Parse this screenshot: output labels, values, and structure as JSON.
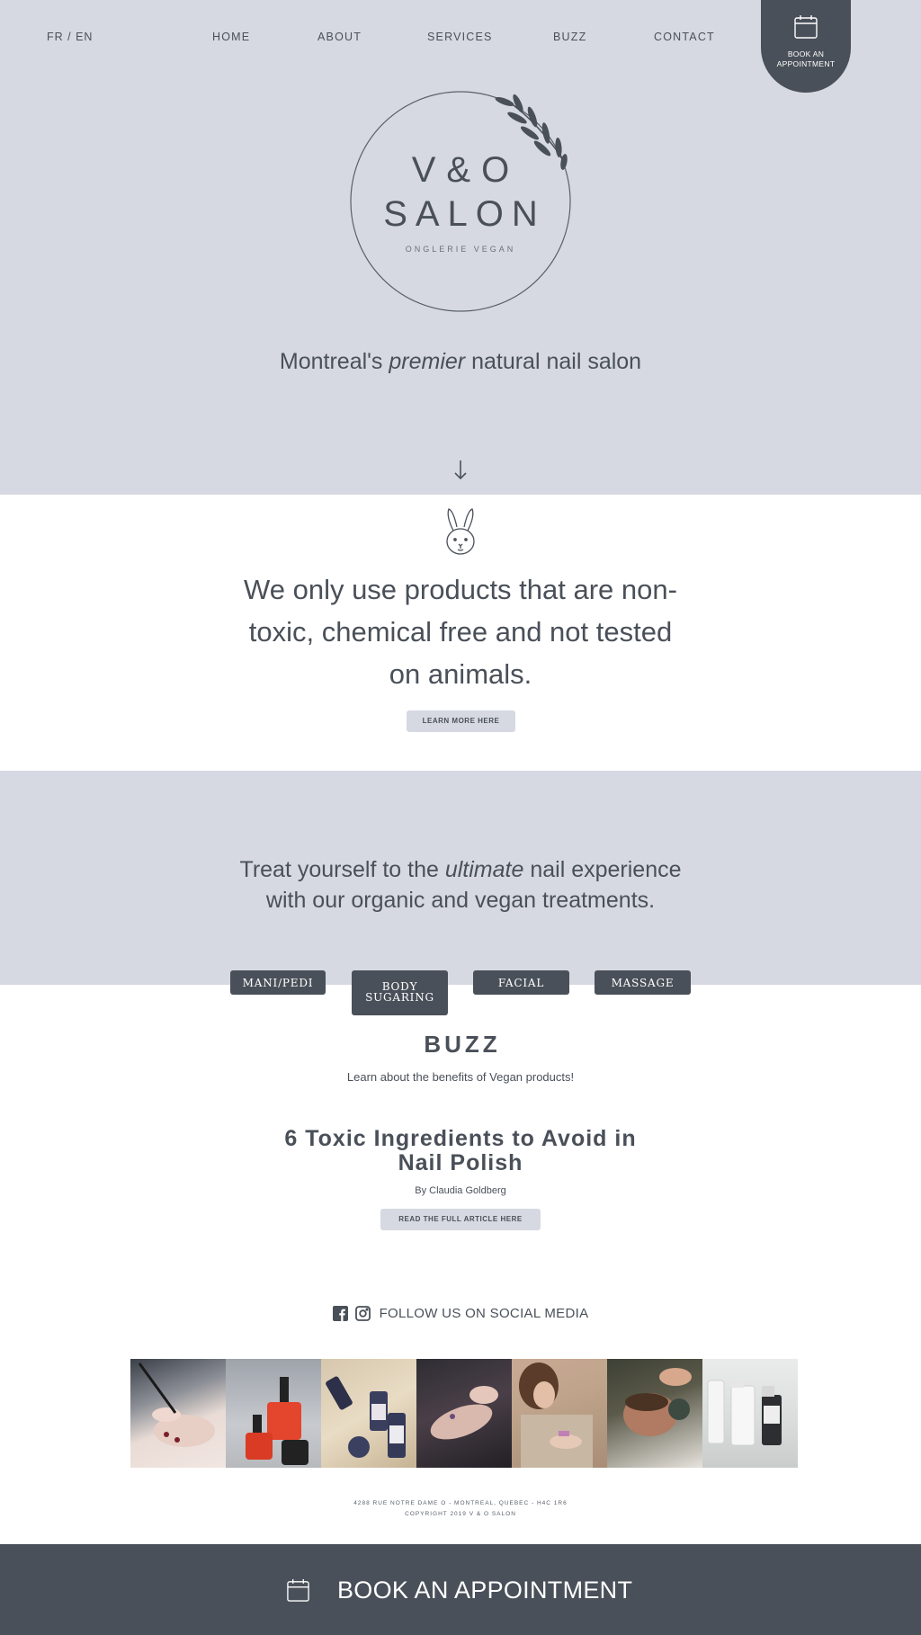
{
  "header": {
    "lang_switch": "FR / EN",
    "nav": [
      "HOME",
      "ABOUT",
      "SERVICES",
      "BUZZ",
      "CONTACT"
    ],
    "book_tab": "BOOK AN\nAPPOINTMENT"
  },
  "logo": {
    "line1": "V&O",
    "line2": "SALON",
    "sub": "ONGLERIE VEGAN"
  },
  "hero": {
    "tagline_a": "Montreal's ",
    "tagline_em": "premier",
    "tagline_b": " natural nail salon"
  },
  "products": {
    "text": "We only use products that are non-toxic, chemical free and not tested on animals.",
    "button": "LEARN MORE HERE"
  },
  "treatments": {
    "line1_a": "Treat yourself to the ",
    "line1_em": "ultimate",
    "line1_b": " nail experience",
    "line2": "with our organic and vegan treatments.",
    "tabs": [
      "MANI/PEDI",
      "BODY\nSUGARING",
      "FACIAL",
      "MASSAGE"
    ]
  },
  "buzz": {
    "title": "BUZZ",
    "subtitle": "Learn about the benefits of Vegan products!",
    "article_title": "6 Toxic Ingredients to Avoid in Nail Polish",
    "article_by": "By Claudia Goldberg",
    "button": "READ THE FULL ARTICLE HERE"
  },
  "social": {
    "label": "FOLLOW US ON SOCIAL MEDIA",
    "icons": [
      "facebook-icon",
      "instagram-icon"
    ]
  },
  "address": {
    "line1": "4288 RUE NOTRE DAME O - MONTREAL, QUEBEC - H4C 1R6",
    "line2": "COPYRIGHT 2019 V & O SALON"
  },
  "footer": {
    "label": "BOOK AN APPOINTMENT"
  },
  "colors": {
    "accent_bg": "#d6d9e2",
    "dark": "#4a5059",
    "white": "#ffffff"
  }
}
